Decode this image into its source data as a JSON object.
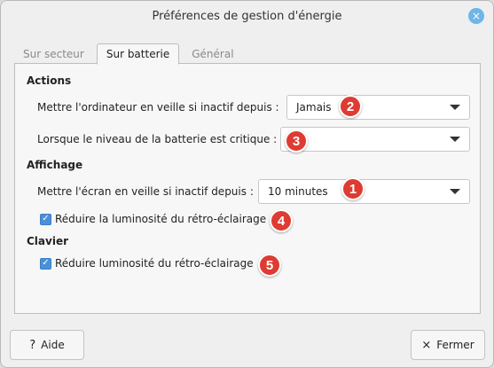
{
  "window": {
    "title": "Préférences de gestion d'énergie",
    "close_icon": "×"
  },
  "tabs": [
    {
      "label": "Sur secteur",
      "active": false
    },
    {
      "label": "Sur batterie",
      "active": true
    },
    {
      "label": "Général",
      "active": false
    }
  ],
  "actions": {
    "section_title": "Actions",
    "sleep_inactive_label": "Mettre l'ordinateur en veille si inactif depuis :",
    "sleep_inactive_value": "Jamais",
    "battery_critical_label": "Lorsque le niveau de la batterie est critique :",
    "battery_critical_value": ""
  },
  "display": {
    "section_title": "Affichage",
    "screen_sleep_label": "Mettre l'écran en veille si inactif depuis :",
    "screen_sleep_value": "10 minutes",
    "reduce_brightness_label": "Réduire la luminosité du rétro-éclairage",
    "reduce_brightness_checked": true
  },
  "keyboard": {
    "section_title": "Clavier",
    "reduce_backlight_label": "Réduire luminosité du rétro-éclairage",
    "reduce_backlight_checked": true
  },
  "badges": {
    "b1": "1",
    "b2": "2",
    "b3": "3",
    "b4": "4",
    "b5": "5"
  },
  "footer": {
    "help_icon": "?",
    "help_label": "Aide",
    "close_icon": "×",
    "close_label": "Fermer"
  },
  "icons": {
    "checkmark": "✓",
    "help": "question-icon",
    "close": "close-icon",
    "dropdown": "chevron-down-icon"
  },
  "colors": {
    "badge": "#de3b32",
    "checkbox": "#4a90d9",
    "close_button": "#6fb6e8"
  }
}
